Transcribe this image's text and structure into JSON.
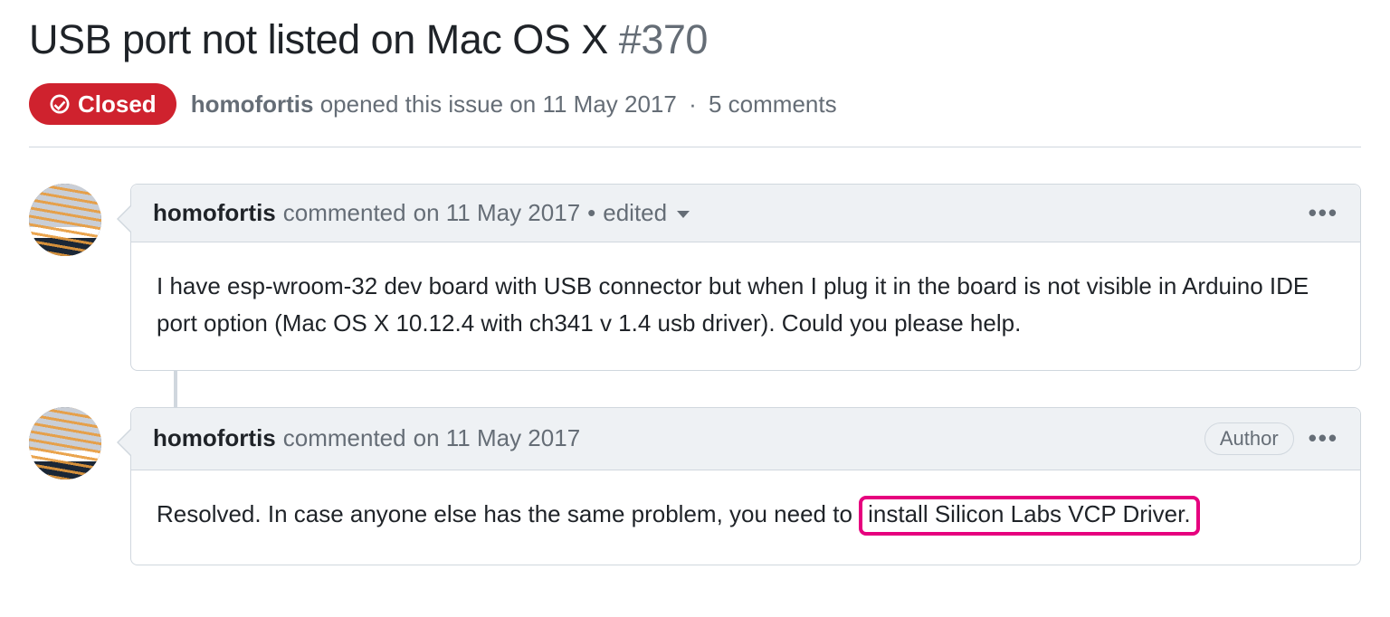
{
  "issue": {
    "title": "USB port not listed on Mac OS X",
    "number": "#370",
    "state": "Closed",
    "author": "homofortis",
    "opened_text": "opened this issue",
    "opened_on": "on 11 May 2017",
    "comments_text": "5 comments"
  },
  "comments": [
    {
      "author": "homofortis",
      "action": "commented",
      "date": "on 11 May 2017",
      "edited_label": "edited",
      "show_edited": true,
      "show_author_badge": false,
      "body_plain": "I have esp-wroom-32 dev board with USB connector but when I plug it in the board is not visible in Arduino IDE port option (Mac OS X 10.12.4 with ch341 v 1.4 usb driver). Could you please help."
    },
    {
      "author": "homofortis",
      "action": "commented",
      "date": "on 11 May 2017",
      "show_edited": false,
      "show_author_badge": true,
      "author_badge_label": "Author",
      "body_prefix": "Resolved. In case anyone else has the same problem, you need to ",
      "body_highlight": "install Silicon Labs VCP Driver."
    }
  ]
}
